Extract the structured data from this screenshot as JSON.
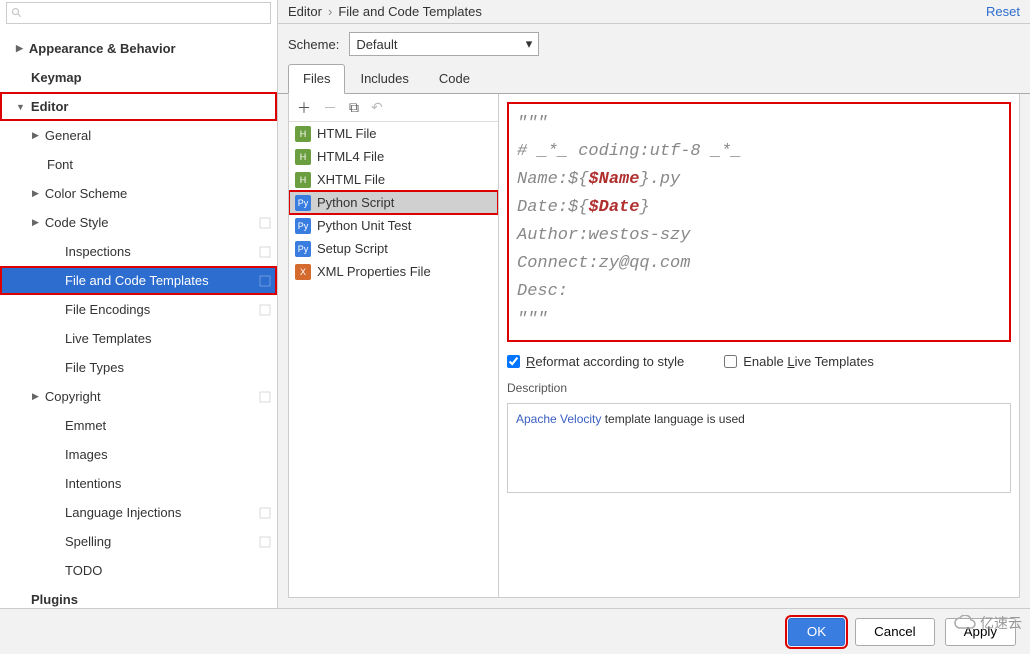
{
  "breadcrumb": {
    "parent": "Editor",
    "current": "File and Code Templates",
    "reset": "Reset"
  },
  "scheme": {
    "label": "Scheme:",
    "value": "Default"
  },
  "sidebar": {
    "appearance": "Appearance & Behavior",
    "keymap": "Keymap",
    "editor": "Editor",
    "general": "General",
    "font": "Font",
    "color_scheme": "Color Scheme",
    "code_style": "Code Style",
    "inspections": "Inspections",
    "file_code_templates": "File and Code Templates",
    "file_encodings": "File Encodings",
    "live_templates": "Live Templates",
    "file_types": "File Types",
    "copyright": "Copyright",
    "emmet": "Emmet",
    "images": "Images",
    "intentions": "Intentions",
    "language_injections": "Language Injections",
    "spelling": "Spelling",
    "todo": "TODO",
    "plugins": "Plugins"
  },
  "tabs": {
    "files": "Files",
    "includes": "Includes",
    "code": "Code"
  },
  "files": {
    "html": "HTML File",
    "html4": "HTML4 File",
    "xhtml": "XHTML File",
    "python_script": "Python Script",
    "python_unit_test": "Python Unit Test",
    "setup_script": "Setup Script",
    "xml_properties": "XML Properties File"
  },
  "template": {
    "l1": "\"\"\"",
    "l2": "# _*_ coding:utf-8 _*_",
    "l3a": "Name:${",
    "l3v": "$Name",
    "l3b": "}.py",
    "l4a": "Date:${",
    "l4v": "$Date",
    "l4b": "}",
    "l5": "Author:westos-szy",
    "l6": "Connect:zy@qq.com",
    "l7": "Desc:",
    "l8": "\"\"\""
  },
  "options": {
    "reformat_pre": "R",
    "reformat_post": "eformat according to style",
    "live_pre": "Enable ",
    "live_l": "L",
    "live_post": "ive Templates"
  },
  "description": {
    "label": "Description",
    "velocity": "Apache Velocity",
    "rest": " template language is used"
  },
  "buttons": {
    "ok": "OK",
    "cancel": "Cancel",
    "apply": "Apply"
  },
  "watermark": "亿速云"
}
